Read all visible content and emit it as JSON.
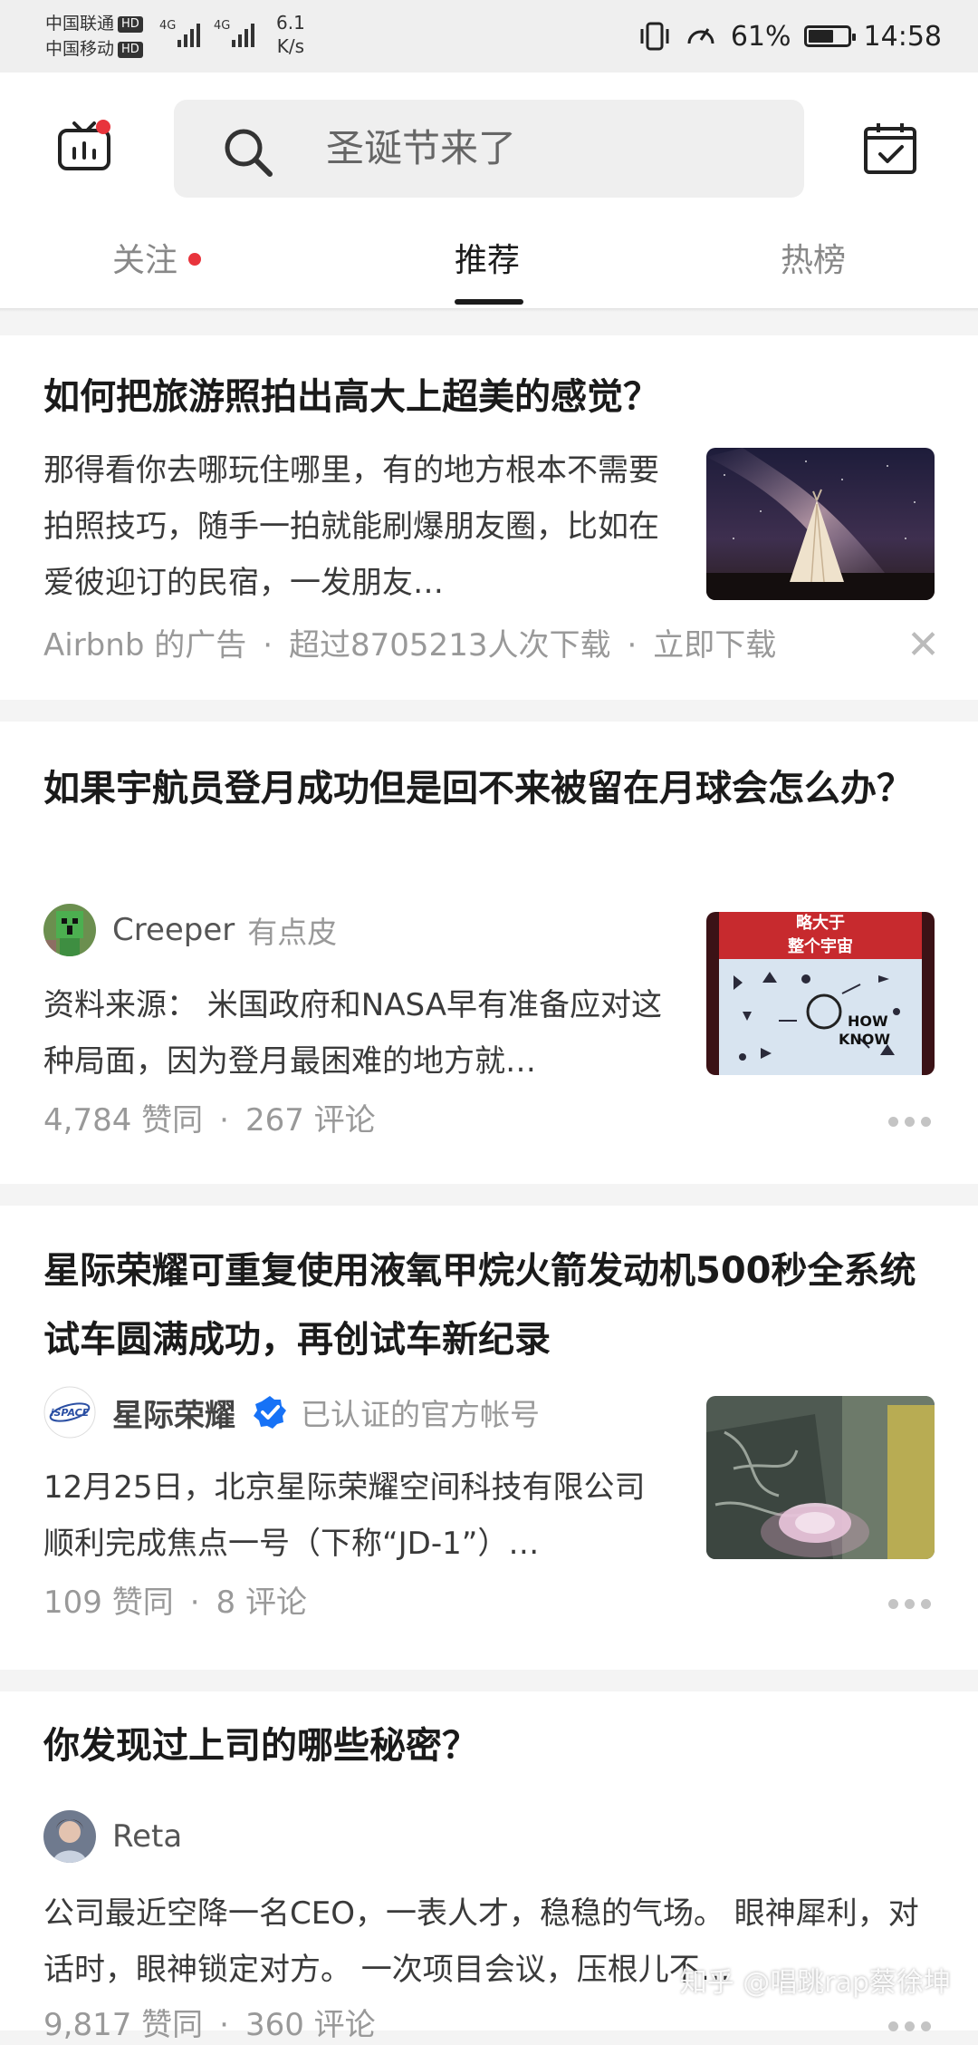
{
  "status_bar": {
    "carrier1": "中国联通",
    "carrier2": "中国移动",
    "hd": "HD",
    "net1": "4G",
    "net2": "4G",
    "speed_value": "6.1",
    "speed_unit": "K/s",
    "battery": "61%",
    "time": "14:58"
  },
  "header": {
    "search_placeholder": "圣诞节来了",
    "tabs": [
      {
        "label": "关注",
        "dot": true
      },
      {
        "label": "推荐",
        "active": true
      },
      {
        "label": "热榜"
      }
    ]
  },
  "feed": [
    {
      "title": "如何把旅游照拍出高大上超美的感觉？",
      "excerpt": "那得看你去哪玩住哪里，有的地方根本不需要拍照技巧，随手一拍就能刷爆朋友圈，比如在爱彼迎订的民宿，一发朋友…",
      "ad_source": "Airbnb 的广告",
      "ad_downloads": "超过8705213人次下载",
      "ad_action": "立即下载",
      "thumb": "teepee-under-milky-way"
    },
    {
      "title": "如果宇航员登月成功但是回不来被留在月球会怎么办？",
      "author": "Creeper",
      "author_tag": "有点皮",
      "excerpt": "资料来源： 米国政府和NASA早有准备应对这种局面，因为登月最困难的地方就…",
      "upvotes": "4,784 赞同",
      "comments": "267 评论",
      "thumb_text1": "略大于",
      "thumb_text2": "整个宇宙",
      "thumb_text3": "HOW",
      "thumb_text4": "KNOW"
    },
    {
      "title": "星际荣耀可重复使用液氧甲烷火箭发动机500秒全系统试车圆满成功，再创试车新纪录",
      "author": "星际荣耀",
      "author_tag": "已认证的官方帐号",
      "avatar_text": "iSPACE",
      "excerpt": "12月25日，北京星际荣耀空间科技有限公司顺利完成焦点一号（下称“JD-1”）…",
      "upvotes": "109 赞同",
      "comments": "8 评论",
      "thumb": "rocket-engine-test"
    },
    {
      "title": "你发现过上司的哪些秘密？",
      "author": "Reta",
      "excerpt": "公司最近空降一名CEO，一表人才，稳稳的气场。 眼神犀利，对话时，眼神锁定对方。 一次项目会议，压根儿不…",
      "upvotes": "9,817 赞同",
      "comments": "360 评论"
    }
  ],
  "watermark": "知乎 @唱跳rap蔡徐坤",
  "colors": {
    "accent_red": "#e8343c",
    "verify_blue": "#1772f6"
  }
}
